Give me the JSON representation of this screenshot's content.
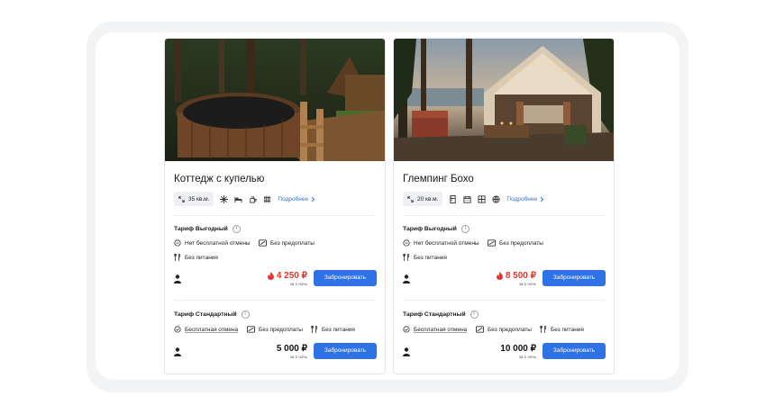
{
  "cards": [
    {
      "title": "Коттедж с купелью",
      "area": "35 кв.м.",
      "amenities": [
        "snowflake-icon",
        "bed-icon",
        "kettle-icon",
        "heater-icon"
      ],
      "more_label": "Подробнее",
      "tariffs": [
        {
          "name": "Тариф Выгодный",
          "conditions": [
            "Нет бесплатной отмены",
            "Без предоплаты",
            "Без питания"
          ],
          "price": "4 250 ₽",
          "price_note": "за 1 ночь",
          "hot": true,
          "book_label": "Забронировать"
        },
        {
          "name": "Тариф Стандартный",
          "conditions": [
            "Бесплатная отмена",
            "Без предоплаты",
            "Без питания"
          ],
          "price": "5 000 ₽",
          "price_note": "за 1 ночь",
          "hot": false,
          "book_label": "Забронировать"
        }
      ]
    },
    {
      "title": "Глемпинг Бохо",
      "area": "20 кв.м.",
      "amenities": [
        "fridge-icon",
        "calendar-icon",
        "window-icon",
        "globe-icon"
      ],
      "more_label": "Подробнее",
      "tariffs": [
        {
          "name": "Тариф Выгодный",
          "conditions": [
            "Нет бесплатной отмены",
            "Без предоплаты",
            "Без питания"
          ],
          "price": "8 500 ₽",
          "price_note": "за 1 ночь",
          "hot": true,
          "book_label": "Забронировать"
        },
        {
          "name": "Тариф Стандартный",
          "conditions": [
            "Бесплатная отмена",
            "Без предоплаты",
            "Без питания"
          ],
          "price": "10 000 ₽",
          "price_note": "за 1 ночь",
          "hot": false,
          "book_label": "Забронировать"
        }
      ]
    }
  ],
  "colors": {
    "accent": "#2f72e6",
    "hot_price": "#e0362c",
    "link": "#2f6fe0"
  }
}
